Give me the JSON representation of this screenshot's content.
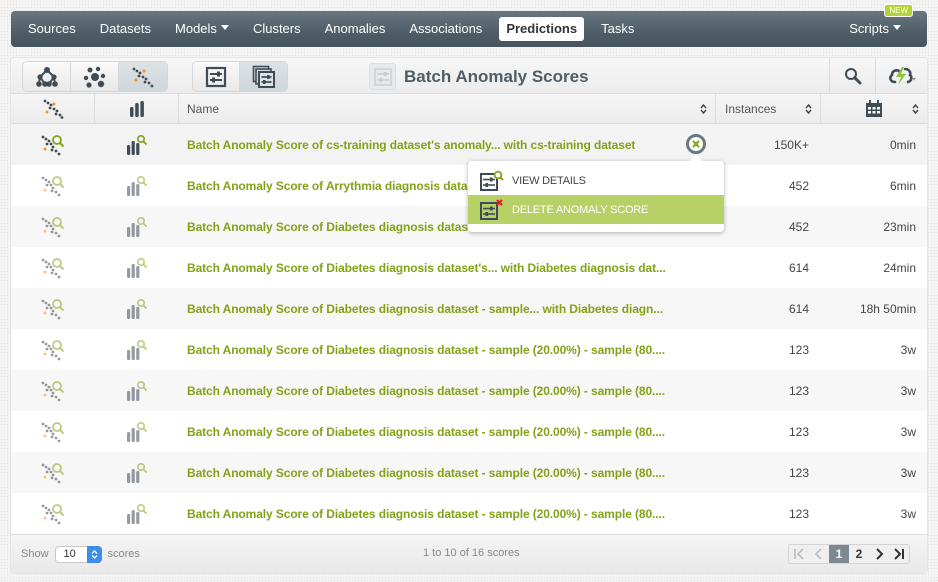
{
  "topnav": {
    "items": [
      {
        "label": "Sources"
      },
      {
        "label": "Datasets"
      },
      {
        "label": "Models",
        "dropdown": true
      },
      {
        "label": "Clusters"
      },
      {
        "label": "Anomalies"
      },
      {
        "label": "Associations"
      },
      {
        "label": "Predictions",
        "active": true
      },
      {
        "label": "Tasks"
      }
    ],
    "scripts_label": "Scripts",
    "new_badge": "NEW"
  },
  "toolbar": {
    "view_buttons": [
      "model-tree-icon",
      "cluster-icon",
      "anomaly-icon"
    ],
    "mode_buttons": [
      "single-prediction-icon",
      "batch-prediction-icon"
    ],
    "title": "Batch Anomaly Scores",
    "search_icon": "search-icon",
    "action_icon": "cloud-lightning-icon"
  },
  "table": {
    "columns": {
      "anomaly_icon": "anomaly-icon",
      "dataset_icon": "bar-chart-icon",
      "name": "Name",
      "instances": "Instances",
      "date_icon": "calendar-icon"
    },
    "rows": [
      {
        "name": "Batch Anomaly Score of cs-training dataset's anomaly... with cs-training dataset",
        "instances": "150K+",
        "age": "0min",
        "selected": true
      },
      {
        "name": "Batch Anomaly Score of Arrythmia diagnosis dataset's anomaly... with Arrythmia diagnosis dataset",
        "instances": "452",
        "age": "6min"
      },
      {
        "name": "Batch Anomaly Score of Diabetes diagnosis dataset's anomaly... with Arrythmia diagnosis dataset",
        "instances": "452",
        "age": "23min"
      },
      {
        "name": "Batch Anomaly Score of Diabetes diagnosis dataset's... with Diabetes diagnosis dat...",
        "instances": "614",
        "age": "24min"
      },
      {
        "name": "Batch Anomaly Score of Diabetes diagnosis dataset - sample... with Diabetes diagn...",
        "instances": "614",
        "age": "18h 50min"
      },
      {
        "name": "Batch Anomaly Score of Diabetes diagnosis dataset - sample (20.00%) - sample (80....",
        "instances": "123",
        "age": "3w"
      },
      {
        "name": "Batch Anomaly Score of Diabetes diagnosis dataset - sample (20.00%) - sample (80....",
        "instances": "123",
        "age": "3w"
      },
      {
        "name": "Batch Anomaly Score of Diabetes diagnosis dataset - sample (20.00%) - sample (80....",
        "instances": "123",
        "age": "3w"
      },
      {
        "name": "Batch Anomaly Score of Diabetes diagnosis dataset - sample (20.00%) - sample (80....",
        "instances": "123",
        "age": "3w"
      },
      {
        "name": "Batch Anomaly Score of Diabetes diagnosis dataset - sample (20.00%) - sample (80....",
        "instances": "123",
        "age": "3w"
      }
    ]
  },
  "context_menu": {
    "items": [
      {
        "label": "VIEW DETAILS",
        "icon": "view-details-icon"
      },
      {
        "label": "DELETE ANOMALY SCORE",
        "icon": "delete-icon",
        "highlighted": true
      }
    ]
  },
  "footer": {
    "show_label": "Show",
    "page_size": "10",
    "unit_label": "scores",
    "range_text": "1 to 10 of 16 scores",
    "pages": [
      "1",
      "2"
    ],
    "current_page": "1"
  },
  "colors": {
    "accent_green": "#84a218",
    "highlight_green": "#b8d166",
    "nav_bg": "#4e5d66",
    "badge_green": "#b2d235",
    "anomaly_orange": "#f29a1c"
  }
}
